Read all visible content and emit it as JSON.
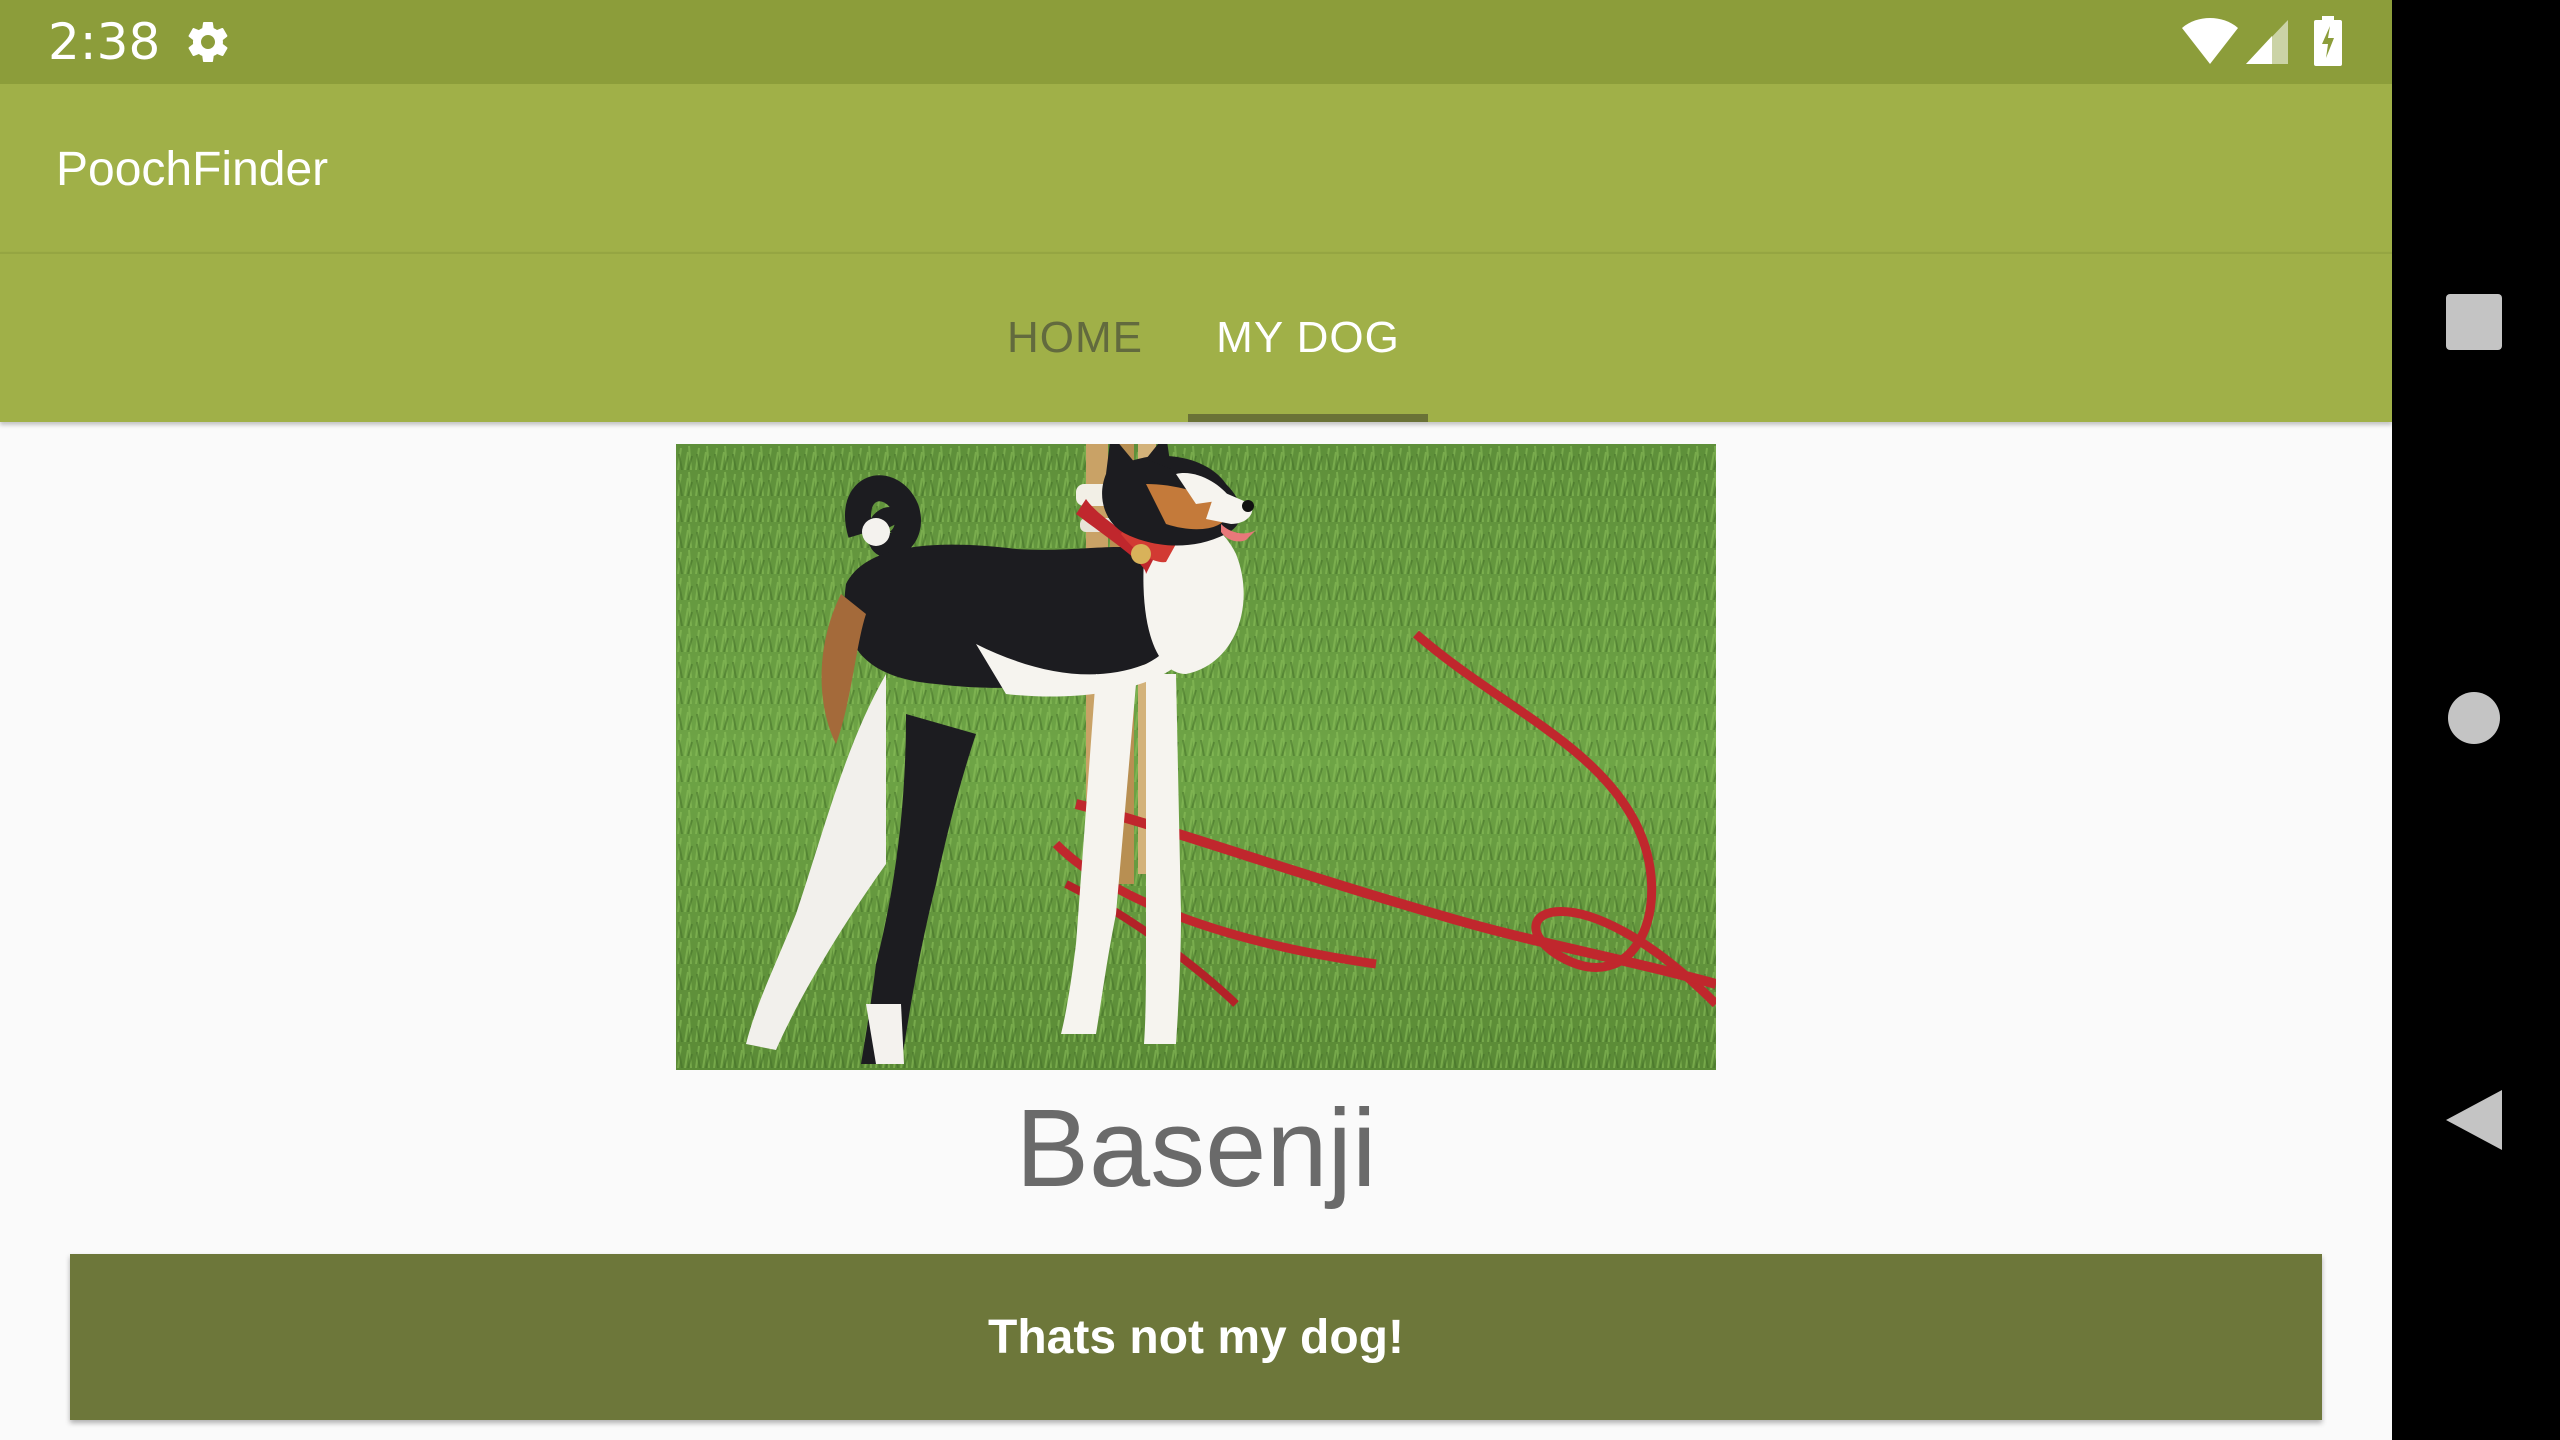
{
  "status_bar": {
    "time": "2:38",
    "icons": [
      "gear-icon",
      "wifi-icon",
      "signal-icon",
      "battery-charging-icon"
    ],
    "color": "#8c9d3a"
  },
  "app_bar": {
    "title": "PoochFinder",
    "color": "#a0b048"
  },
  "tabs": [
    {
      "label": "HOME",
      "selected": false
    },
    {
      "label": "MY DOG",
      "selected": true
    }
  ],
  "dog": {
    "breed": "Basenji",
    "photo_icon": "dog-photo"
  },
  "actions": {
    "not_my_dog_label": "Thats not my dog!",
    "button_color": "#6d773a"
  },
  "nav_bar": {
    "buttons": [
      "recents-icon",
      "home-icon",
      "back-icon"
    ]
  }
}
